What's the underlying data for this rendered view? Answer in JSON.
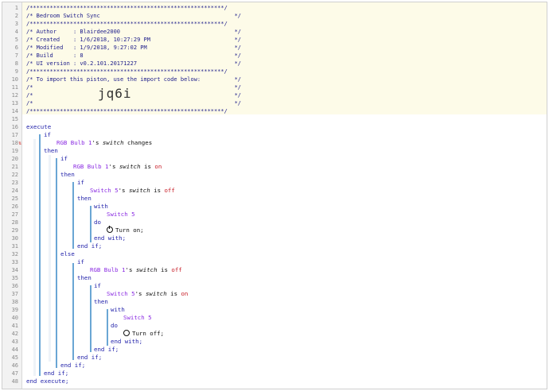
{
  "line_numbers": [
    "1",
    "2",
    "3",
    "4",
    "5",
    "6",
    "7",
    "8",
    "9",
    "10",
    "11",
    "12",
    "13",
    "14",
    "15",
    "16",
    "17",
    "18",
    "19",
    "20",
    "21",
    "22",
    "23",
    "24",
    "25",
    "26",
    "27",
    "28",
    "29",
    "30",
    "31",
    "32",
    "33",
    "34",
    "35",
    "36",
    "37",
    "38",
    "39",
    "40",
    "41",
    "42",
    "43",
    "44",
    "45",
    "46",
    "47",
    "48"
  ],
  "header": {
    "border": "/**********************************************************/",
    "title": "/* Bedroom Switch Sync",
    "author": "/* Author     : Blairdee2000",
    "created": "/* Created    : 1/6/2018, 10:27:29 PM",
    "modified": "/* Modified   : 1/9/2018, 9:27:02 PM",
    "build": "/* Build      : 8",
    "ui_version": "/* UI version : v0.2.101.20171227",
    "import_note": "/* To import this piston, use the import code below:",
    "blank": "/*",
    "end": "*/",
    "import_code": "jq6i"
  },
  "code": {
    "execute": "execute",
    "end_execute": "end execute;",
    "if": "if",
    "then": "then",
    "else": "else",
    "end_if": "end if;",
    "with": "with",
    "do": "do",
    "end_with": "end with;",
    "device_rgb": "RGB Bulb 1",
    "device_switch": "Switch 5",
    "poss": "'s ",
    "attr_switch": "switch",
    "changes": " changes",
    "is": " is ",
    "val_on": "on",
    "val_off": "off",
    "turn_on": "Turn on;",
    "turn_off": "Turn off;"
  },
  "icons": {
    "gutter_marker": "condition-marker-icon",
    "turn_on": "power-on-icon",
    "turn_off": "power-off-icon"
  },
  "colors": {
    "keyword": "#2222aa",
    "device": "#8a2be2",
    "value": "#c8202a",
    "header_bg": "#fdfbe8",
    "block_line": "#6aa6d4"
  }
}
